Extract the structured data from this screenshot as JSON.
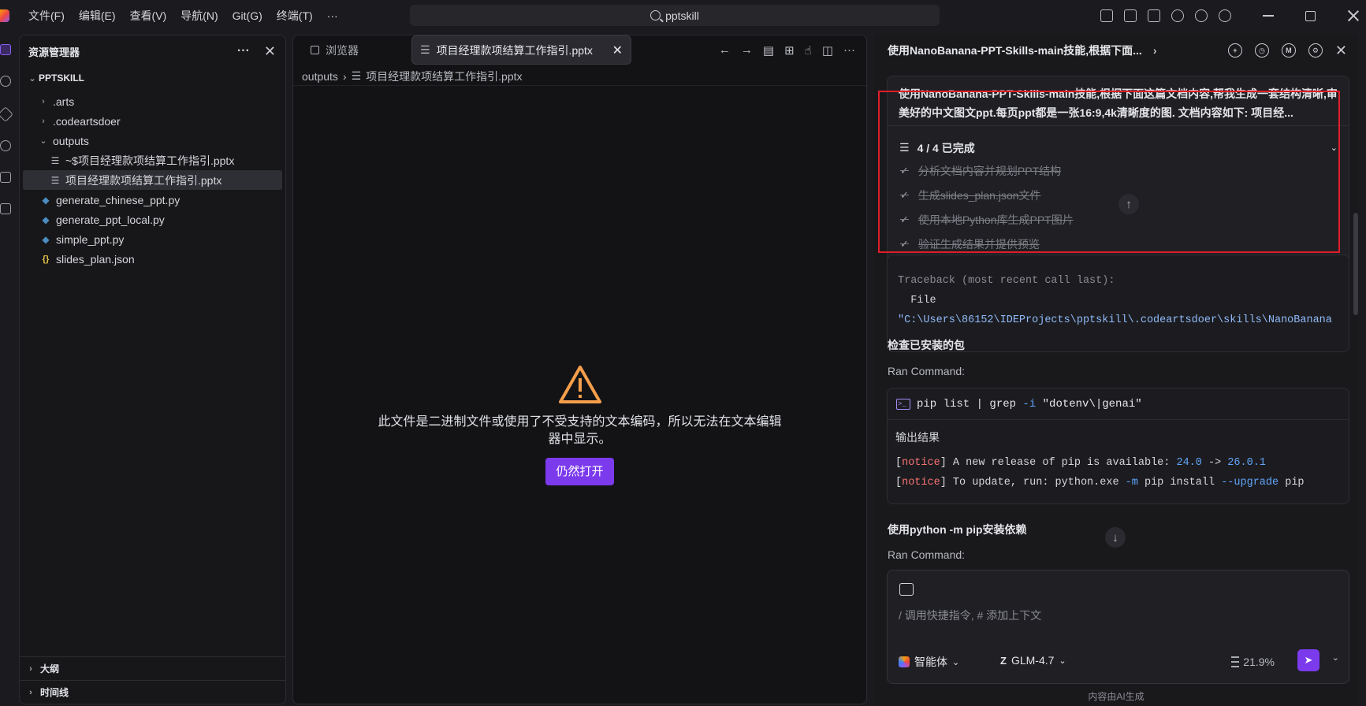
{
  "menu": [
    "文件(F)",
    "编辑(E)",
    "查看(V)",
    "导航(N)",
    "Git(G)",
    "终端(T)",
    "···"
  ],
  "search": {
    "text": "pptskill"
  },
  "explorer": {
    "title": "资源管理器",
    "more": "···",
    "project": "PPTSKILL",
    "items": [
      {
        "label": ".arts",
        "type": "folder"
      },
      {
        "label": ".codeartsdoer",
        "type": "folder"
      },
      {
        "label": "outputs",
        "type": "folder-open"
      },
      {
        "label": "~$项目经理款项结算工作指引.pptx",
        "type": "doc"
      },
      {
        "label": "项目经理款项结算工作指引.pptx",
        "type": "doc"
      },
      {
        "label": "generate_chinese_ppt.py",
        "type": "py"
      },
      {
        "label": "generate_ppt_local.py",
        "type": "py"
      },
      {
        "label": "simple_ppt.py",
        "type": "py"
      },
      {
        "label": "slides_plan.json",
        "type": "json"
      }
    ],
    "outline": "大纲",
    "timeline": "时间线"
  },
  "editor": {
    "tabs": [
      {
        "label": "浏览器"
      },
      {
        "label": "项目经理款项结算工作指引.pptx"
      }
    ],
    "breadcrumb": {
      "folder": "outputs",
      "file": "项目经理款项结算工作指引.pptx"
    },
    "warning": "此文件是二进制文件或使用了不受支持的文本编码，所以无法在文本编辑器中显示。",
    "open_anyway": "仍然打开"
  },
  "chat": {
    "title": "使用NanoBanana-PPT-Skills-main技能,根据下面...",
    "prompt": "使用NanoBanana-PPT-Skills-main技能,根据下面这篇文档内容,帮我生成一套结构清晰,审美好的中文图文ppt.每页ppt都是一张16:9,4k清晰度的图. 文档内容如下: 项目经...",
    "progress": "4 / 4 已完成",
    "tasks": [
      "分析文档内容并规划PPT结构",
      "生成slides_plan.json文件",
      "使用本地Python库生成PPT图片",
      "验证生成结果并提供预览"
    ],
    "traceback": {
      "line1": "Traceback (most recent call last):",
      "line2": "  File",
      "line3": "\"C:\\Users\\86152\\IDEProjects\\pptskill\\.codeartsdoer\\skills\\NanoBanana"
    },
    "section1": "检查已安装的包",
    "ran_command": "Ran Command:",
    "command": {
      "cmd": "pip list | grep ",
      "flag": "-i",
      "arg": " \"dotenv\\|genai\""
    },
    "output_label": "输出结果",
    "output": {
      "l1_notice": "notice",
      "l1_text": " A new release of pip is available: ",
      "l1_from": "24.0",
      "l1_arrow": " -> ",
      "l1_to": "26.0.1",
      "l2_notice": "notice",
      "l2_text": " To update, run: python.exe ",
      "l2_flag1": "-m",
      "l2_mid": " pip install ",
      "l2_flag2": "--upgrade",
      "l2_end": " pip"
    },
    "section2": "使用python -m pip安装依赖",
    "ran_command2": "Ran Command:",
    "input_placeholder": "/ 调用快捷指令, # 添加上下文",
    "agent": "智能体",
    "model": "GLM-4.7",
    "ctx_usage": "21.9%",
    "footnote": "内容由AI生成"
  },
  "colors": {
    "accent": "#7c3aed",
    "highlight": "#e11d2a"
  }
}
